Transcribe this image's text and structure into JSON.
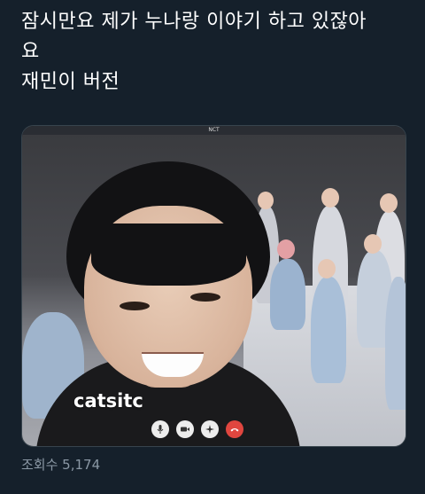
{
  "tweet": {
    "line1": "잠시만요 제가 누나랑 이야기 하고 있잖아",
    "line2": "요",
    "line3": "재민이 버전"
  },
  "media": {
    "window_title": "NCT",
    "caller_name": "catsitc",
    "controls": [
      {
        "icon": "microphone-icon"
      },
      {
        "icon": "video-camera-icon"
      },
      {
        "icon": "effects-icon"
      },
      {
        "icon": "end-call-icon",
        "color": "#e0463f"
      }
    ]
  },
  "footer": {
    "views": "조회수 5,174"
  },
  "colors": {
    "background": "#15202b",
    "text": "#ffffff",
    "muted": "#8b98a5",
    "end_call": "#e0463f"
  }
}
